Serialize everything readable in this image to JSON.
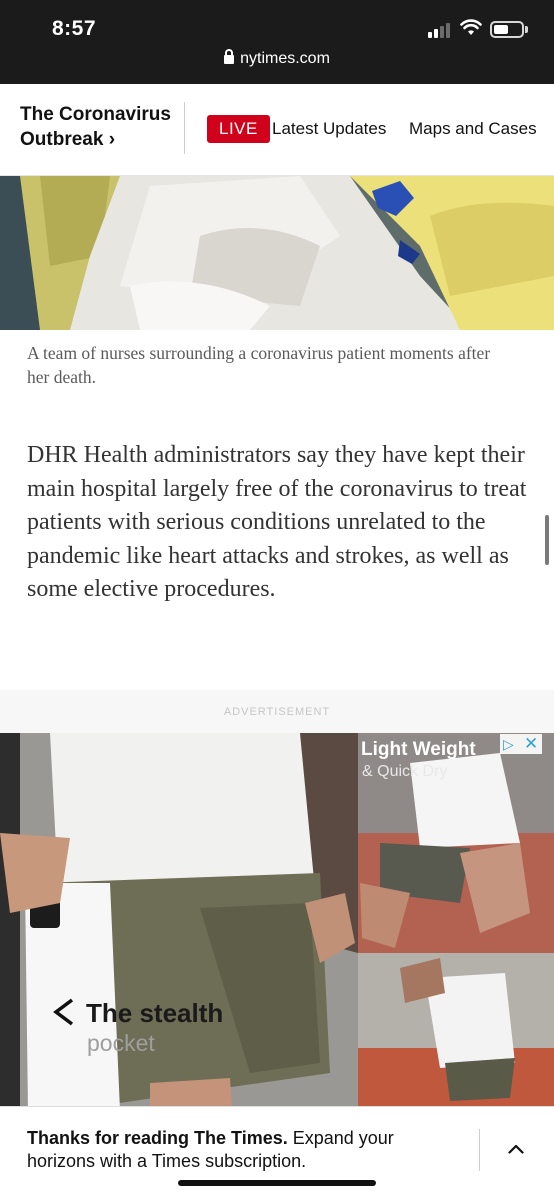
{
  "status_bar": {
    "time": "8:57",
    "url": "nytimes.com"
  },
  "nav": {
    "section_title": "The Coronavirus Outbreak ›",
    "live_badge": "LIVE",
    "latest_updates": "Latest Updates",
    "maps_and_cases": "Maps and Cases"
  },
  "photo": {
    "caption": "A team of nurses surrounding a coronavirus patient moments after her death."
  },
  "article": {
    "paragraph": "DHR Health administrators say they have kept their main hospital largely free of the coronavirus to treat patients with serious conditions unrelated to the pandemic like heart attacks and strokes, as well as some elective procedures."
  },
  "ad": {
    "label": "ADVERTISEMENT",
    "headline_top": "Light Weight",
    "subline_top": "& Quick Dry",
    "headline_main": "The stealth",
    "subline_main": "pocket"
  },
  "subscribe_bar": {
    "bold_text": "Thanks for reading The Times.",
    "rest_text": " Expand your horizons with a Times subscription."
  },
  "colors": {
    "live_red": "#d0021b",
    "status_bar_bg": "#1b1b1b",
    "adchoices_blue": "#32a0d8"
  }
}
